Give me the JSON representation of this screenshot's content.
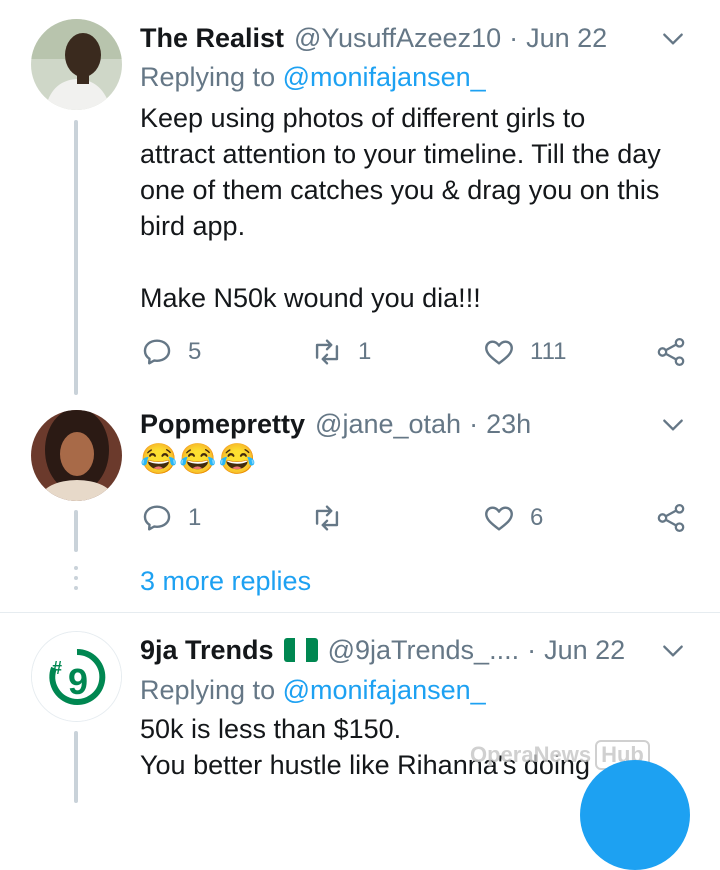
{
  "tweets": [
    {
      "name": "The Realist",
      "handle": "@YusuffAzeez10",
      "time": "Jun 22",
      "replying_prefix": "Replying to",
      "replying_mention": "@monifajansen_",
      "text": "Keep using photos of different girls to\nattract attention to your timeline. Till the day\none of them catches you & drag you on this\nbird app.\n\nMake N50k wound you dia!!!",
      "replies": "5",
      "retweets": "1",
      "likes": "111"
    },
    {
      "name": "Popmepretty",
      "handle": "@jane_otah",
      "time": "23h",
      "text": "😂😂😂",
      "replies": "1",
      "retweets": "",
      "likes": "6"
    },
    {
      "name": "9ja Trends",
      "handle": "@9jaTrends_....",
      "time": "Jun 22",
      "replying_prefix": "Replying to",
      "replying_mention": "@monifajansen_",
      "text": "50k is less than $150.\nYou better hustle like Rihanna's doing"
    }
  ],
  "more_replies": "3 more replies",
  "watermark": {
    "left": "OperaNews",
    "right": "Hub"
  },
  "colors": {
    "accent": "#1da1f2",
    "muted": "#657786",
    "thread": "#c9d2d9",
    "divider": "#e6ecf0",
    "flag_green": "#008751"
  },
  "icons": [
    "reply-icon",
    "retweet-icon",
    "like-icon",
    "share-icon",
    "chevron-down-icon",
    "compose-fab"
  ]
}
